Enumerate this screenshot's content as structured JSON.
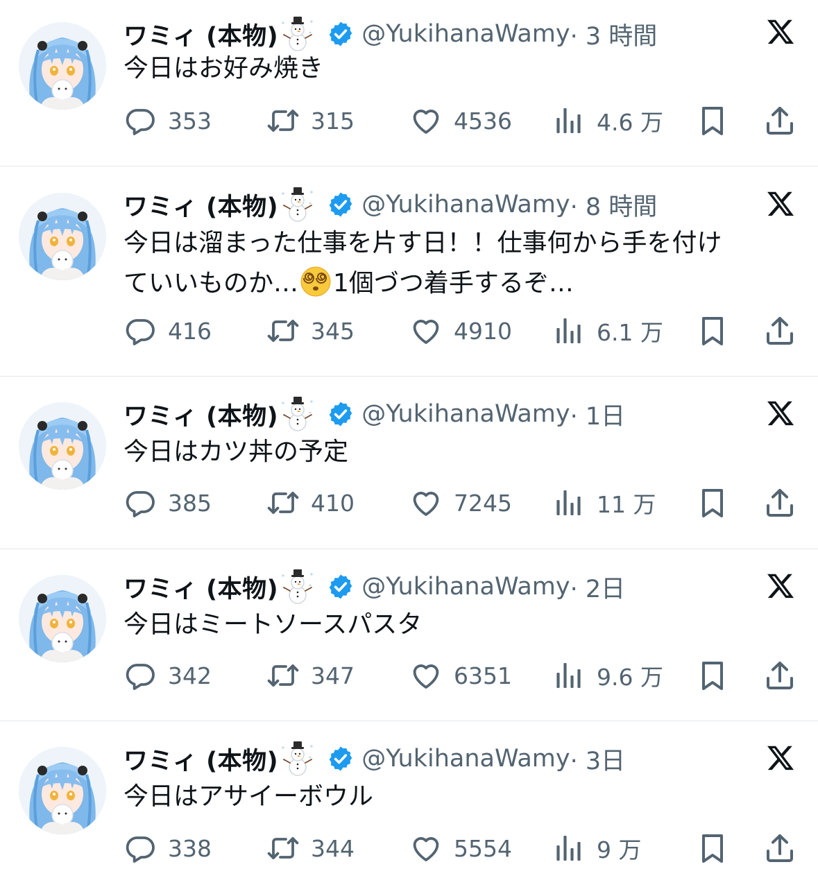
{
  "user": {
    "display_name": "ワミィ (本物)",
    "handle": "@YukihanaWamy",
    "name_emoji": "snowman-emoji",
    "verified_color": "#1d9bf0"
  },
  "tweets": [
    {
      "time": "· 3 時間",
      "lines": [
        "今日はお好み焼き"
      ],
      "replies": "353",
      "retweets": "315",
      "likes": "4536",
      "views": "4.6 万"
    },
    {
      "time": "· 8 時間",
      "lines": [
        "今日は溜まった仕事を片す日！！仕事何から手を付け",
        "ていいものか…",
        "1個づつ着手するぞ…"
      ],
      "replies": "416",
      "retweets": "345",
      "likes": "4910",
      "views": "6.1 万"
    },
    {
      "time": "· 1日",
      "lines": [
        "今日はカツ丼の予定"
      ],
      "replies": "385",
      "retweets": "410",
      "likes": "7245",
      "views": "11 万"
    },
    {
      "time": "· 2日",
      "lines": [
        "今日はミートソースパスタ"
      ],
      "replies": "342",
      "retweets": "347",
      "likes": "6351",
      "views": "9.6 万"
    },
    {
      "time": "· 3日",
      "lines": [
        "今日はアサイーボウル"
      ],
      "replies": "338",
      "retweets": "344",
      "likes": "5554",
      "views": "9 万"
    }
  ],
  "icons": {
    "reply": "reply-icon",
    "retweet": "retweet-icon",
    "like": "heart-icon",
    "views": "views-icon",
    "bookmark": "bookmark-icon",
    "share": "share-icon",
    "platform": "x-logo-icon",
    "dizzy": "dizzy-face-emoji"
  },
  "colors": {
    "text": "#0f1419",
    "secondary": "#536471",
    "divider": "#e3e6ea"
  }
}
